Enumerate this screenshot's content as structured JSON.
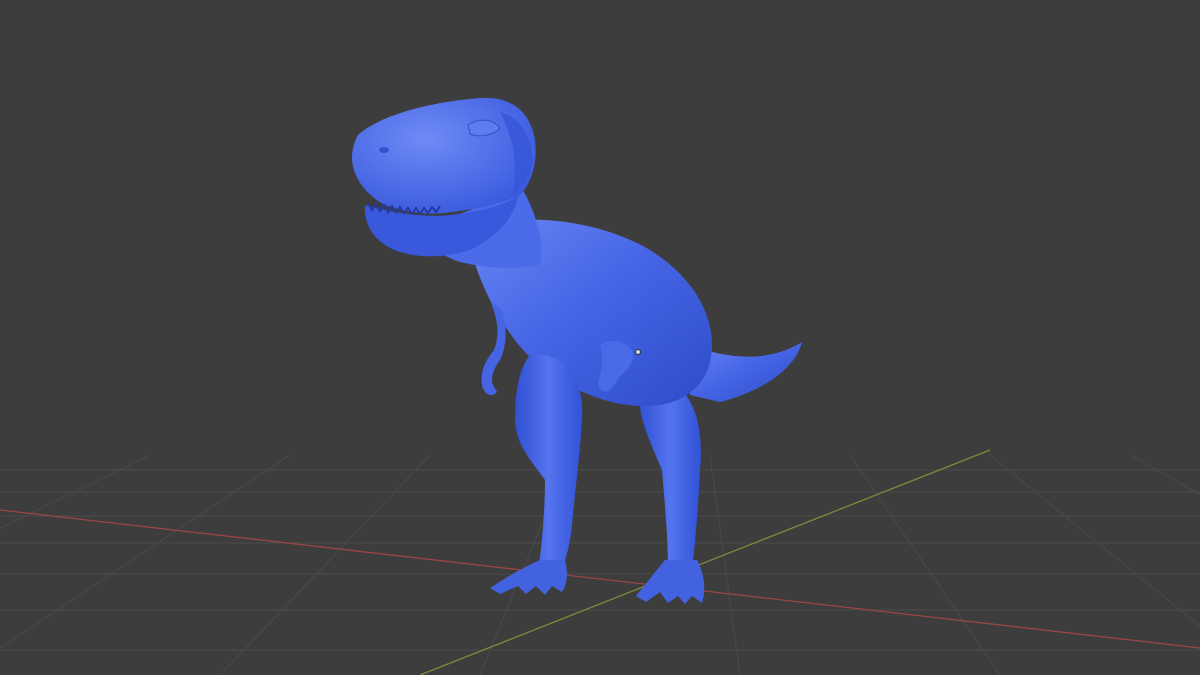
{
  "viewport": {
    "background_color": "#3d3d3d",
    "grid_color": "#4a4a4a",
    "x_axis_color": "#9b4545",
    "y_axis_color": "#7d8a3c",
    "model_color": "#3f5fe0",
    "origin_color": "#cfcfcf"
  },
  "model": {
    "name_icon": "t-rex-mesh",
    "selected": true
  }
}
